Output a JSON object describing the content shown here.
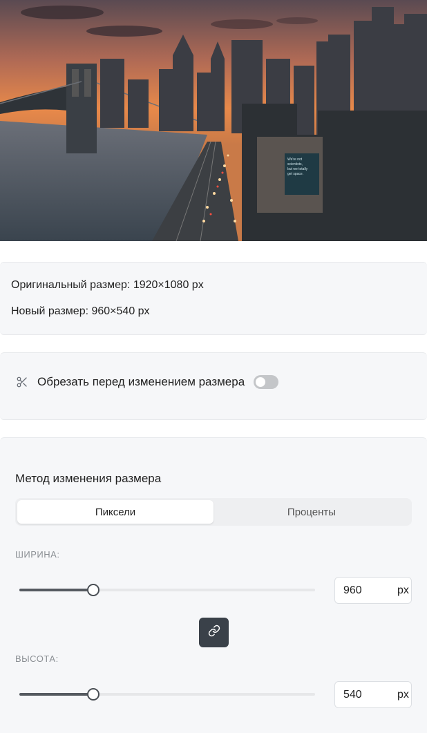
{
  "preview": {
    "colors": {
      "sky_top": "#5a4a52",
      "sky_glow": "#e8894a",
      "water": "#4a5560"
    },
    "billboard_text": [
      "We're not",
      "scientists,",
      "but we totally",
      "get space."
    ]
  },
  "info": {
    "original_size": "Оригинальный размер: 1920×1080 px",
    "new_size": "Новый размер: 960×540 px"
  },
  "crop": {
    "icon": "scissors-icon",
    "label": "Обрезать перед изменением размера",
    "enabled": false
  },
  "resize": {
    "title": "Метод изменения размера",
    "tabs": [
      {
        "label": "Пиксели",
        "active": true
      },
      {
        "label": "Проценты",
        "active": false
      }
    ],
    "width": {
      "label": "ШИРИНА:",
      "value": "960",
      "unit": "px",
      "fraction": 0.25
    },
    "link_icon": "link-icon",
    "height": {
      "label": "ВЫСОТА:",
      "value": "540",
      "unit": "px",
      "fraction": 0.25
    },
    "accent_color": "#3a4149"
  }
}
